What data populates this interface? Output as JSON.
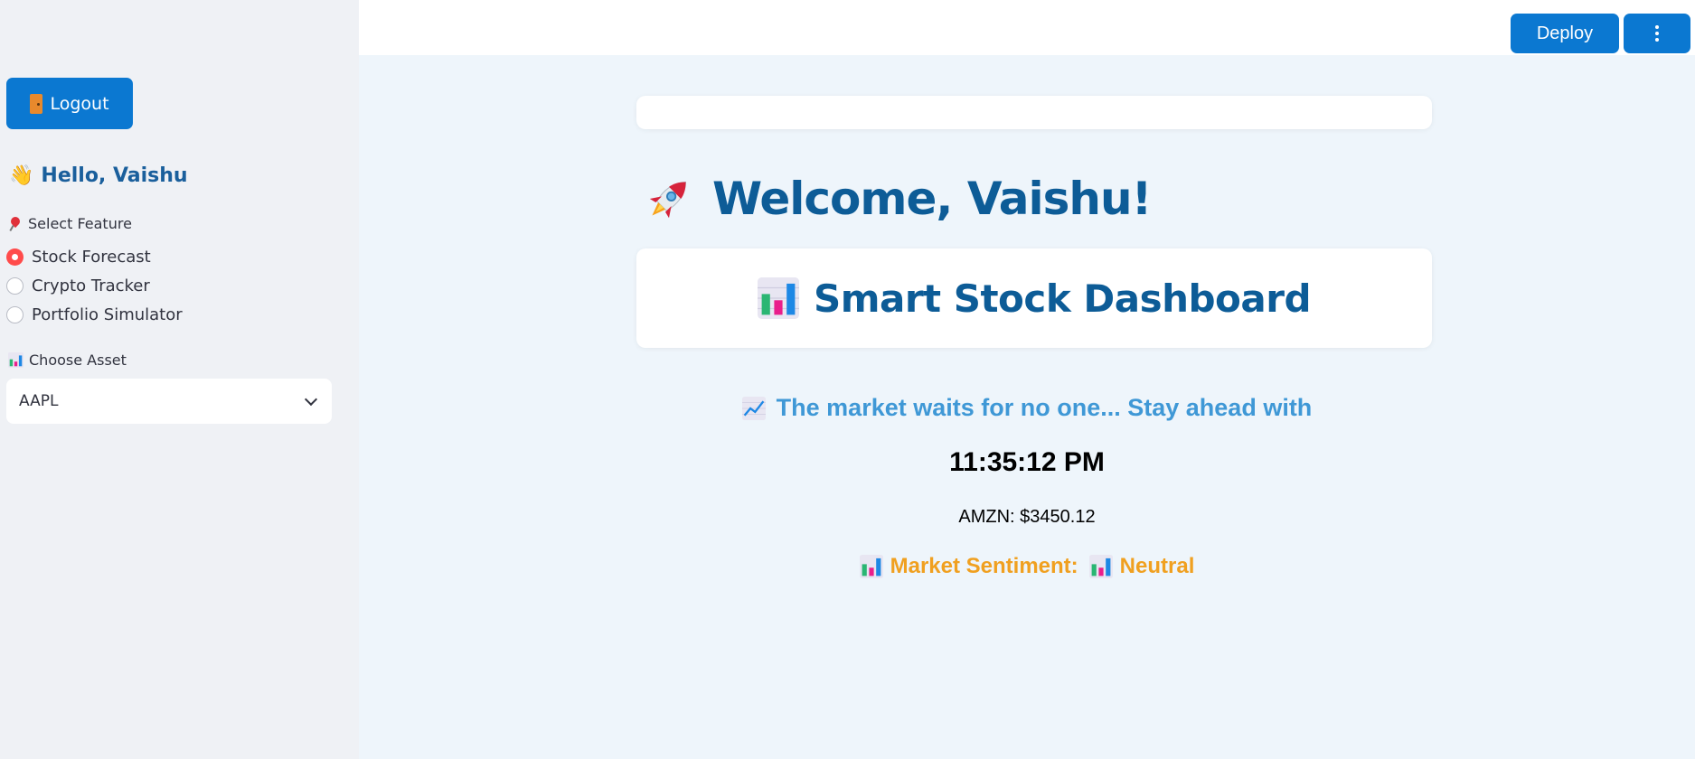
{
  "sidebar": {
    "logout_label": "Logout",
    "hello_text": "Hello, Vaishu",
    "feature_label": "Select Feature",
    "features": [
      {
        "label": "Stock Forecast",
        "selected": true
      },
      {
        "label": "Crypto Tracker",
        "selected": false
      },
      {
        "label": "Portfolio Simulator",
        "selected": false
      }
    ],
    "asset_label": "Choose Asset",
    "asset_value": "AAPL"
  },
  "header": {
    "deploy_label": "Deploy"
  },
  "main": {
    "welcome": "Welcome, Vaishu!",
    "dashboard_title": "Smart Stock Dashboard",
    "tagline": "The market waits for no one... Stay ahead with",
    "clock": "11:35:12 PM",
    "ticker": "AMZN: $3450.12",
    "sentiment_label": "Market Sentiment:",
    "sentiment_value": "Neutral"
  },
  "colors": {
    "accent": "#0b78d1",
    "heading": "#0d5c97",
    "radio_selected": "#ff4b4b",
    "tagline": "#3f98d6",
    "sentiment": "#f0a020"
  },
  "icons": [
    "door-icon",
    "wave-icon",
    "pin-icon",
    "bar-chart-icon",
    "chevron-down-icon",
    "rocket-icon",
    "trend-chart-icon",
    "menu-dots-icon"
  ]
}
